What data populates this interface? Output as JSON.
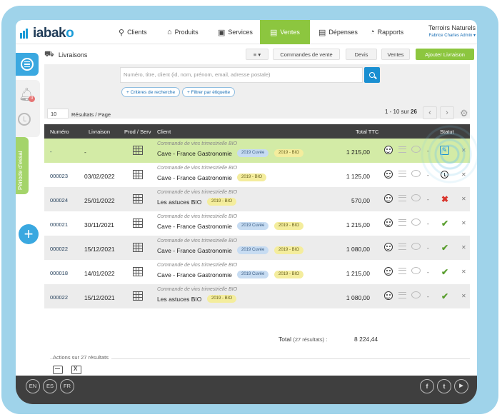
{
  "brand": {
    "name_main": "iaba",
    "name_end": "o",
    "name_k": "k"
  },
  "nav": {
    "items": [
      {
        "label": "Clients",
        "icon": "user-icon"
      },
      {
        "label": "Produits",
        "icon": "tag-icon"
      },
      {
        "label": "Services",
        "icon": "briefcase-icon"
      },
      {
        "label": "Ventes",
        "icon": "cart-icon",
        "active": true
      },
      {
        "label": "Dépenses",
        "icon": "receipt-icon"
      },
      {
        "label": "Rapports",
        "icon": "pie-chart-icon"
      }
    ]
  },
  "account": {
    "name": "Terroirs Naturels",
    "user": "Fabrice Charles Admin"
  },
  "sidebar": {
    "notification_count": "0",
    "trial_label": "Période d'essai"
  },
  "subheader": {
    "title": "Livraisons",
    "buttons": {
      "menu": "≡ ▾",
      "orders": "Commandes de vente",
      "quotes": "Devis",
      "sales": "Ventes",
      "add": "Ajouter Livraison"
    }
  },
  "search": {
    "placeholder": "Numéro, titre, client (id, nom, prénom, email, adresse postale)",
    "chips": [
      "+ Critères de recherche",
      "+ Filtrer par étiquette"
    ]
  },
  "pagination": {
    "per_page": "10",
    "per_page_label": "Résultats / Page",
    "range": "1 - 10 sur",
    "total_pages": "26"
  },
  "table": {
    "headers": [
      "Numéro",
      "Livraison",
      "Prod / Serv",
      "Client",
      "Total TTC",
      "Statut"
    ],
    "rows": [
      {
        "number": "-",
        "date": "-",
        "description": "Commande de vins trimestrielle BIO",
        "client": "Cave - France Gastronomie",
        "tags": [
          "2019 Cuvée",
          "2019 - BIO"
        ],
        "total": "1 215,00",
        "status": "edit"
      },
      {
        "number": "000023",
        "date": "03/02/2022",
        "description": "Commande de vins trimestrielle BIO",
        "client": "Cave - France Gastronomie",
        "tags": [
          "2019 - BIO"
        ],
        "total": "1 125,00",
        "status": "pending"
      },
      {
        "number": "000024",
        "date": "25/01/2022",
        "description": "Commande de vins trimestrielle BIO",
        "client": "Les astuces BIO",
        "tags": [
          "2019 - BIO"
        ],
        "total": "570,00",
        "status": "cancelled"
      },
      {
        "number": "000021",
        "date": "30/11/2021",
        "description": "Commande de vins trimestrielle BIO",
        "client": "Cave - France Gastronomie",
        "tags": [
          "2019 Cuvée",
          "2019 - BIO"
        ],
        "total": "1 215,00",
        "status": "done"
      },
      {
        "number": "000022",
        "date": "15/12/2021",
        "description": "Commande de vins trimestrielle BIO",
        "client": "Cave - France Gastronomie",
        "tags": [
          "2019 Cuvée",
          "2019 - BIO"
        ],
        "total": "1 080,00",
        "status": "done"
      },
      {
        "number": "000018",
        "date": "14/01/2022",
        "description": "Commande de vins trimestrielle BIO",
        "client": "Cave - France Gastronomie",
        "tags": [
          "2019 Cuvée",
          "2019 - BIO"
        ],
        "total": "1 215,00",
        "status": "done"
      },
      {
        "number": "000022",
        "date": "15/12/2021",
        "description": "Commande de vins trimestrielle BIO",
        "client": "Les astuces BIO",
        "tags": [
          "2019 - BIO"
        ],
        "total": "1 080,00",
        "status": "done"
      }
    ],
    "total_label": "Total",
    "total_count": "(27 résultats) :",
    "total_value": "8 224,44"
  },
  "actions": {
    "label": "Actions sur 27 résultats"
  },
  "footer": {
    "languages": [
      "EN",
      "ES",
      "FR"
    ],
    "social": [
      "f",
      "t",
      "▶"
    ]
  },
  "colors": {
    "accent_green": "#8cc63f",
    "accent_blue": "#1a9bd7",
    "highlight_row": "#d3eba6"
  }
}
